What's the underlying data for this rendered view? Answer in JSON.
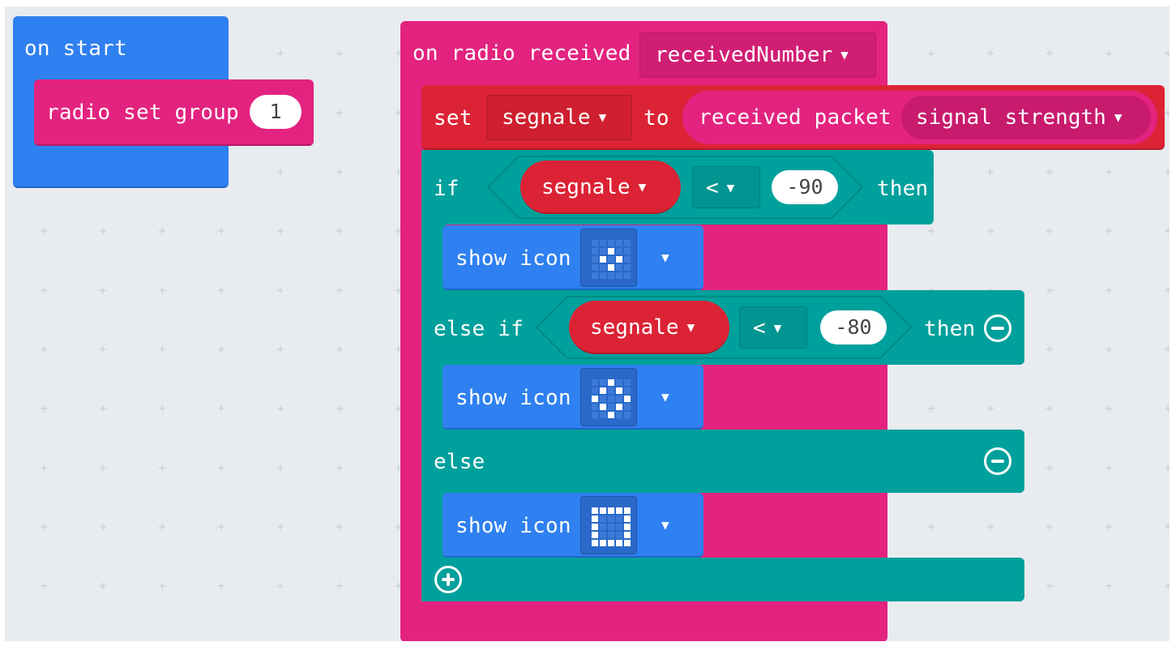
{
  "colors": {
    "workspace": "#e8ebef",
    "basic_blue": "#2f80f0",
    "radio_magenta": "#e3237f",
    "variable_red": "#dc2335",
    "logic_teal": "#00a09c"
  },
  "on_start": {
    "label": "on start",
    "radio_set_group": {
      "label": "radio set group",
      "value": "1"
    }
  },
  "on_radio": {
    "label": "on radio received",
    "param": "receivedNumber",
    "set_block": {
      "set_label": "set",
      "variable": "segnale",
      "to_label": "to",
      "received_packet_label": "received packet",
      "property": "signal strength"
    },
    "if_block": {
      "if_label": "if",
      "then_label": "then",
      "cond1": {
        "variable": "segnale",
        "operator": "<",
        "value": "-90"
      },
      "else_if_label": "else if",
      "cond2": {
        "variable": "segnale",
        "operator": "<",
        "value": "-80"
      },
      "else_label": "else",
      "show_icon_label": "show icon",
      "icons": [
        "small-diamond",
        "diamond",
        "square"
      ]
    }
  },
  "icons": {
    "dropdown": "caret-down-icon",
    "remove": "minus-circle-icon",
    "add": "plus-circle-icon"
  }
}
